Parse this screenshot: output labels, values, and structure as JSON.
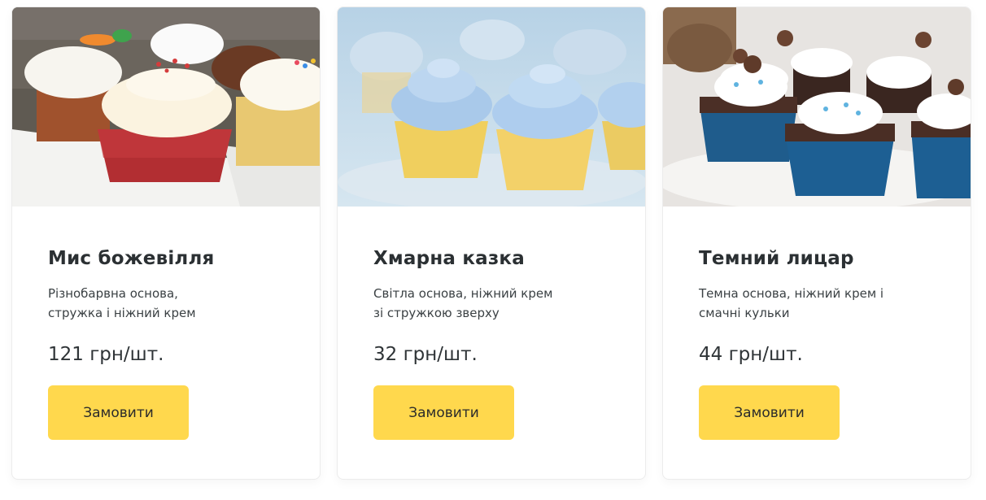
{
  "products": [
    {
      "name": "Мис божевілля",
      "description_lines": [
        "Різнобарвна основа,",
        "стружка і ніжний крем"
      ],
      "price": "121 грн/шт.",
      "button_label": "Замовити",
      "image": "colorful-cupcakes-photo"
    },
    {
      "name": "Хмарна казка",
      "description_lines": [
        "Світла основа, ніжний крем",
        "зі стружкою зверху"
      ],
      "price": "32 грн/шт.",
      "button_label": "Замовити",
      "image": "blue-cream-cupcakes-photo"
    },
    {
      "name": "Темний лицар",
      "description_lines": [
        "Темна основа, ніжний крем і",
        "смачні кульки"
      ],
      "price": "44 грн/шт.",
      "button_label": "Замовити",
      "image": "chocolate-cupcakes-photo"
    }
  ],
  "colors": {
    "button": "#ffd84d",
    "title": "#2b3033",
    "text": "#3b4144",
    "card_border": "#ececec"
  }
}
